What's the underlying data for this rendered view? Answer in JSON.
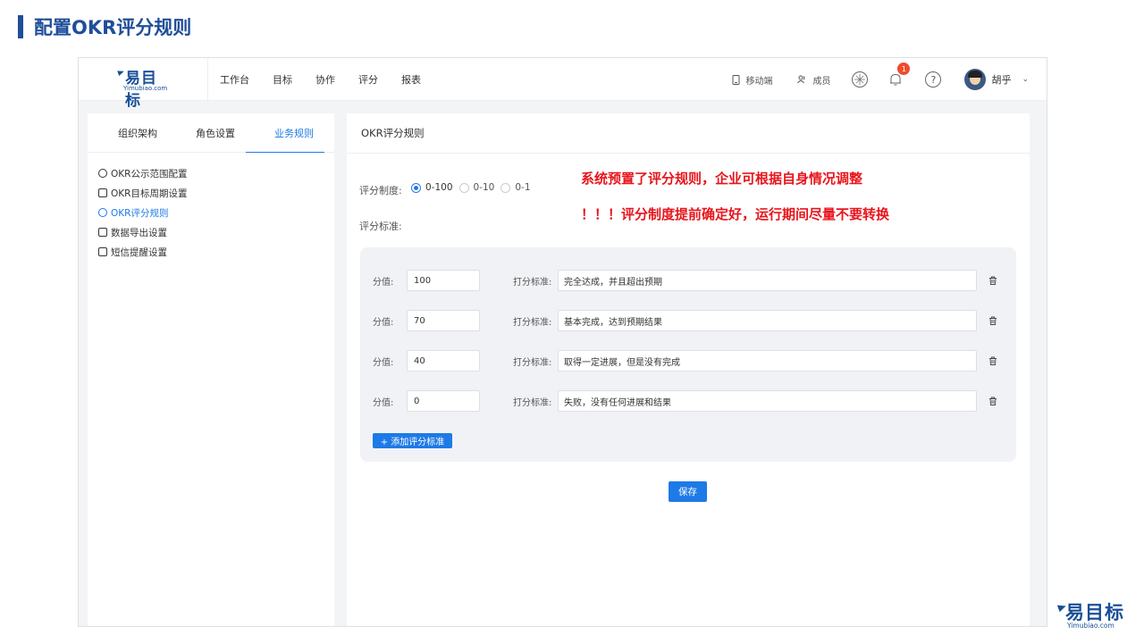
{
  "slide": {
    "title": "配置OKR评分规则"
  },
  "brand": {
    "name_cn": "易目标",
    "name_en": "Yimubiao.com",
    "color": "#1a4f98"
  },
  "topnav": {
    "items": [
      "工作台",
      "目标",
      "协作",
      "评分",
      "报表"
    ]
  },
  "toolbar": {
    "mobile": "移动端",
    "members": "成员",
    "notification_count": "1",
    "help": "?",
    "user_name": "胡乎",
    "caret": "⌄"
  },
  "sidebar": {
    "tabs": [
      "组织架构",
      "角色设置",
      "业务规则"
    ],
    "active_tab": "业务规则",
    "menu": [
      {
        "label": "OKR公示范围配置",
        "icon": "shield-icon"
      },
      {
        "label": "OKR目标周期设置",
        "icon": "calendar-icon"
      },
      {
        "label": "OKR评分规则",
        "icon": "badge-icon",
        "active": true
      },
      {
        "label": "数据导出设置",
        "icon": "export-icon"
      },
      {
        "label": "短信提醒设置",
        "icon": "document-icon"
      }
    ]
  },
  "main": {
    "title": "OKR评分规则",
    "scoring_system_label": "评分制度:",
    "scoring_options": [
      "0-100",
      "0-10",
      "0-1"
    ],
    "scoring_selected": "0-100",
    "criteria_label": "评分标准:",
    "note1": "系统预置了评分规则，企业可根据自身情况调整",
    "note2": "！！！评分制度提前确定好，运行期间尽量不要转换",
    "score_label": "分值:",
    "criterion_label": "打分标准:",
    "criteria": [
      {
        "score": "100",
        "desc": "完全达成，并且超出预期"
      },
      {
        "score": "70",
        "desc": "基本完成，达到预期结果"
      },
      {
        "score": "40",
        "desc": "取得一定进展，但是没有完成"
      },
      {
        "score": "0",
        "desc": "失败，没有任何进展和结果"
      }
    ],
    "add_button": "+ 添加评分标准",
    "save_button": "保存"
  },
  "colors": {
    "accent": "#1e7ae6",
    "alert": "#e8141b",
    "title": "#1f4e99"
  }
}
